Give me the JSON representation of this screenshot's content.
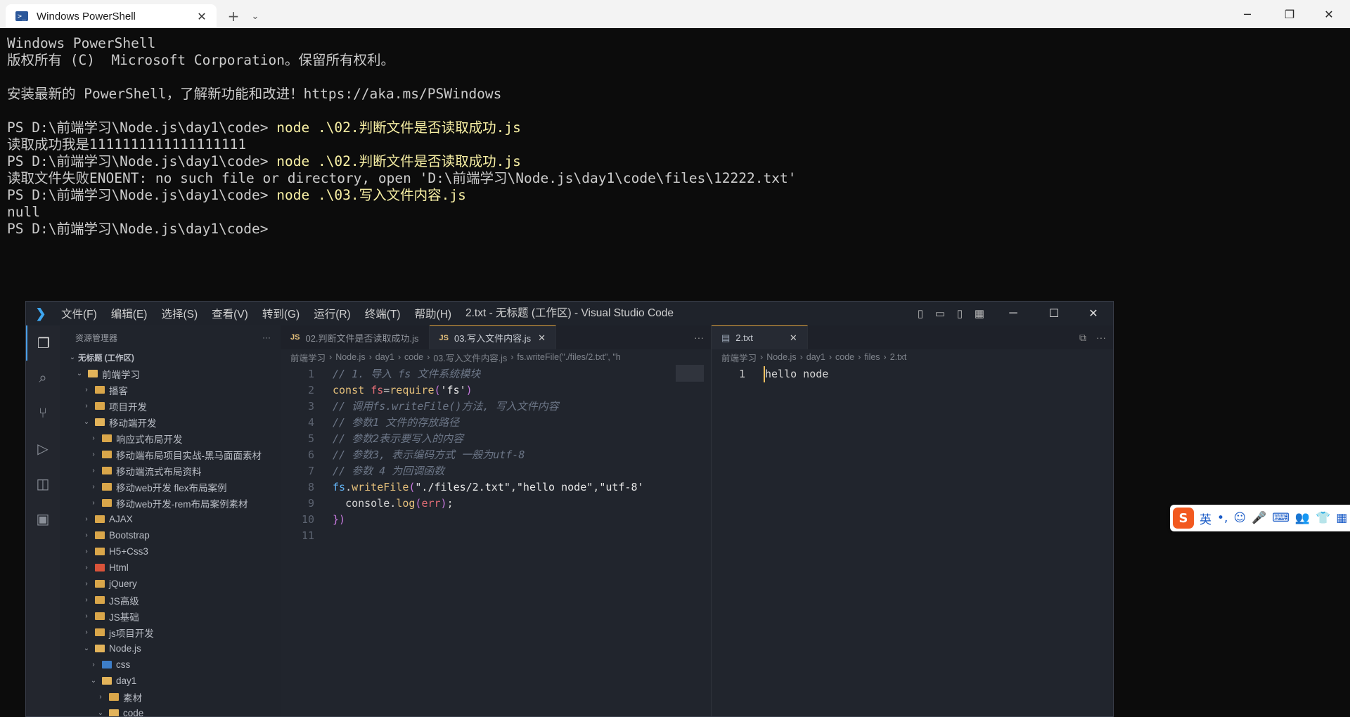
{
  "terminal_window": {
    "tab_title": "Windows PowerShell",
    "tab_close": "✕",
    "new_tab": "+",
    "dropdown": "⌄",
    "minimize": "─",
    "restore": "❐",
    "close": "✕",
    "lines": [
      {
        "prompt": "Windows PowerShell",
        "cmd": ""
      },
      {
        "prompt": "版权所有 (C)  Microsoft Corporation。保留所有权利。",
        "cmd": ""
      },
      {
        "prompt": "",
        "cmd": ""
      },
      {
        "prompt": "安装最新的 PowerShell，了解新功能和改进！https://aka.ms/PSWindows",
        "cmd": ""
      },
      {
        "prompt": "",
        "cmd": ""
      },
      {
        "prompt": "PS D:\\前端学习\\Node.js\\day1\\code> ",
        "cmd": "node .\\02.判断文件是否读取成功.js"
      },
      {
        "prompt": "读取成功我是1111111111111111111",
        "cmd": ""
      },
      {
        "prompt": "PS D:\\前端学习\\Node.js\\day1\\code> ",
        "cmd": "node .\\02.判断文件是否读取成功.js"
      },
      {
        "prompt": "读取文件失败ENOENT: no such file or directory, open 'D:\\前端学习\\Node.js\\day1\\code\\files\\12222.txt'",
        "cmd": ""
      },
      {
        "prompt": "PS D:\\前端学习\\Node.js\\day1\\code> ",
        "cmd": "node .\\03.写入文件内容.js"
      },
      {
        "prompt": "null",
        "cmd": ""
      },
      {
        "prompt": "PS D:\\前端学习\\Node.js\\day1\\code> ",
        "cmd": ""
      }
    ]
  },
  "vscode": {
    "menu": [
      "文件(F)",
      "编辑(E)",
      "选择(S)",
      "查看(V)",
      "转到(G)",
      "运行(R)",
      "终端(T)",
      "帮助(H)"
    ],
    "window_title": "2.txt - 无标题 (工作区) - Visual Studio Code",
    "explorer": {
      "header": "资源管理器",
      "more": "···",
      "workspace": "无标题 (工作区)",
      "tree": [
        {
          "depth": 1,
          "chevron": "⌄",
          "label": "前端学习",
          "open": true,
          "color": "open"
        },
        {
          "depth": 2,
          "chevron": "›",
          "label": "播客",
          "color": "normal"
        },
        {
          "depth": 2,
          "chevron": "›",
          "label": "项目开发",
          "color": "normal"
        },
        {
          "depth": 2,
          "chevron": "⌄",
          "label": "移动端开发",
          "color": "open"
        },
        {
          "depth": 3,
          "chevron": "›",
          "label": "响应式布局开发",
          "color": "normal"
        },
        {
          "depth": 3,
          "chevron": "›",
          "label": "移动端布局项目实战-黑马面面素材",
          "color": "normal"
        },
        {
          "depth": 3,
          "chevron": "›",
          "label": "移动端流式布局资料",
          "color": "normal"
        },
        {
          "depth": 3,
          "chevron": "›",
          "label": "移动web开发 flex布局案例",
          "color": "normal"
        },
        {
          "depth": 3,
          "chevron": "›",
          "label": "移动web开发-rem布局案例素材",
          "color": "normal"
        },
        {
          "depth": 2,
          "chevron": "›",
          "label": "AJAX",
          "color": "normal"
        },
        {
          "depth": 2,
          "chevron": "›",
          "label": "Bootstrap",
          "color": "normal"
        },
        {
          "depth": 2,
          "chevron": "›",
          "label": "H5+Css3",
          "color": "normal"
        },
        {
          "depth": 2,
          "chevron": "›",
          "label": "Html",
          "color": "red"
        },
        {
          "depth": 2,
          "chevron": "›",
          "label": "jQuery",
          "color": "normal"
        },
        {
          "depth": 2,
          "chevron": "›",
          "label": "JS高级",
          "color": "normal"
        },
        {
          "depth": 2,
          "chevron": "›",
          "label": "JS基础",
          "color": "normal"
        },
        {
          "depth": 2,
          "chevron": "›",
          "label": "js项目开发",
          "color": "normal"
        },
        {
          "depth": 2,
          "chevron": "⌄",
          "label": "Node.js",
          "color": "open"
        },
        {
          "depth": 3,
          "chevron": "›",
          "label": "css",
          "color": "blue"
        },
        {
          "depth": 3,
          "chevron": "⌄",
          "label": "day1",
          "color": "open"
        },
        {
          "depth": 4,
          "chevron": "›",
          "label": "素材",
          "color": "normal"
        },
        {
          "depth": 4,
          "chevron": "⌄",
          "label": "code",
          "color": "open"
        }
      ]
    },
    "editor_left": {
      "tabs": [
        {
          "badge": "JS",
          "label": "02.判断文件是否读取成功.js",
          "active": false
        },
        {
          "badge": "JS",
          "label": "03.写入文件内容.js",
          "active": true,
          "close": "✕"
        }
      ],
      "more": "···",
      "breadcrumbs": [
        "前端学习",
        "Node.js",
        "day1",
        "code",
        "03.写入文件内容.js",
        "fs.writeFile(\"./files/2.txt\", \"h"
      ],
      "lines": [
        {
          "n": "1",
          "html": "<span class=\"c-cm\">// 1. 导入 fs 文件系统模块</span>"
        },
        {
          "n": "2",
          "html": "<span class=\"c-kw\">const</span> <span class=\"c-var\">fs</span><span class=\"c-txt\">=</span><span class=\"c-fn\">require</span><span class=\"c-br\">(</span><span class=\"c-str\">'fs'</span><span class=\"c-br\">)</span>"
        },
        {
          "n": "3",
          "html": "<span class=\"c-cm\">// 调用fs.writeFile()方法, 写入文件内容</span>"
        },
        {
          "n": "4",
          "html": "<span class=\"c-cm\">// 参数1 文件的存放路径</span>"
        },
        {
          "n": "5",
          "html": "<span class=\"c-cm\">// 参数2表示要写入的内容</span>"
        },
        {
          "n": "6",
          "html": "<span class=\"c-cm\">// 参数3, 表示编码方式 一般为utf-8</span>"
        },
        {
          "n": "7",
          "html": "<span class=\"c-cm\">// 参数 4 为回调函数</span>"
        },
        {
          "n": "8",
          "html": "<span class=\"c-obj\">fs</span><span class=\"c-txt\">.</span><span class=\"c-fn\">writeFile</span><span class=\"c-br\">(</span><span class=\"c-str\">\"./files/2.txt\"</span><span class=\"c-txt\">,</span><span class=\"c-str\">\"hello node\"</span><span class=\"c-txt\">,</span><span class=\"c-str\">\"utf-8'</span>"
        },
        {
          "n": "9",
          "html": "  <span class=\"c-txt\">console.</span><span class=\"c-fn\">log</span><span class=\"c-br\">(</span><span class=\"c-var\">err</span><span class=\"c-br\">)</span><span class=\"c-txt\">;</span>"
        },
        {
          "n": "10",
          "html": "<span class=\"c-br\">})</span>"
        },
        {
          "n": "11",
          "html": ""
        }
      ]
    },
    "editor_right": {
      "tab": {
        "label": "2.txt",
        "close": "✕"
      },
      "actions": [
        "⧉",
        "···"
      ],
      "breadcrumbs": [
        "前端学习",
        "Node.js",
        "day1",
        "code",
        "files",
        "2.txt"
      ],
      "lines": [
        {
          "n": "1",
          "text": "hello node"
        }
      ]
    },
    "window_controls": {
      "minimize": "─",
      "maximize": "☐",
      "close": "✕"
    }
  },
  "ime_toolbar": {
    "logo": "S",
    "items": [
      "英",
      "•,",
      "☺",
      "🎤",
      "⌨",
      "👥",
      "👕",
      "▦"
    ]
  }
}
